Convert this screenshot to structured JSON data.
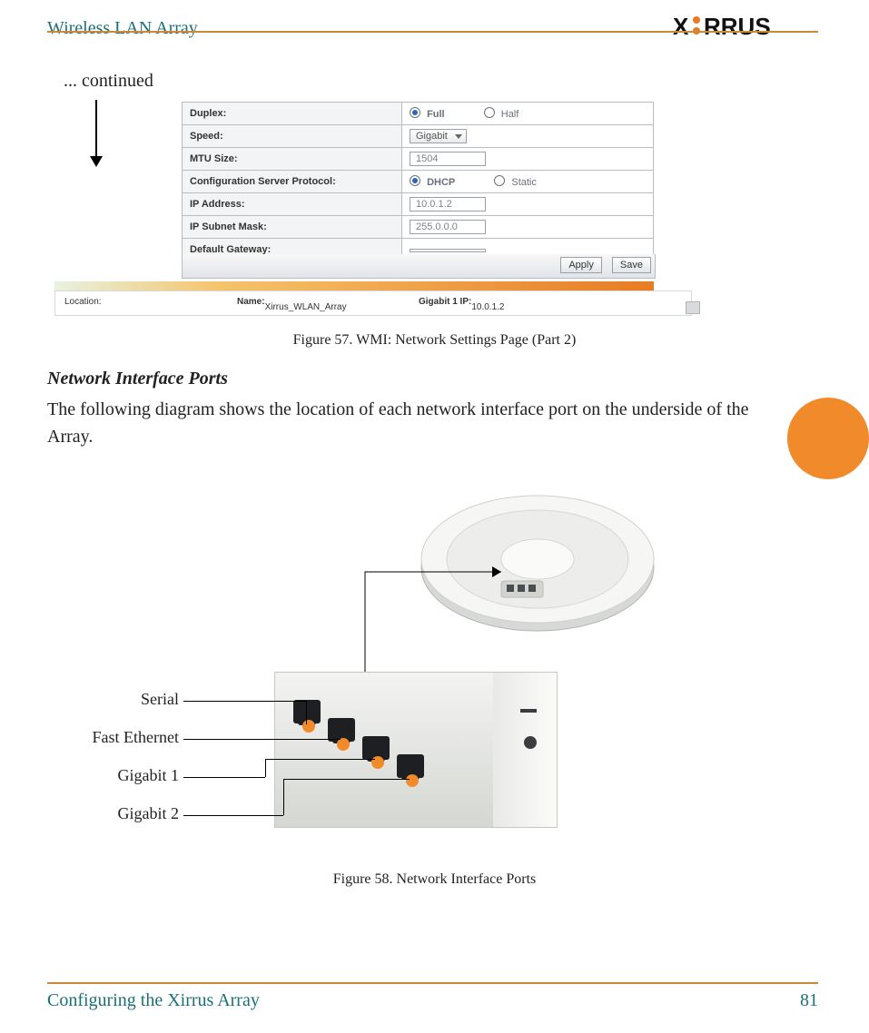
{
  "header": {
    "title": "Wireless LAN Array",
    "logo_text": "XIRRUS"
  },
  "continued": "... continued",
  "wmi": {
    "rows": [
      {
        "label": "Duplex:",
        "type": "radio",
        "opt1": "Full",
        "opt2": "Half",
        "sel": 1
      },
      {
        "label": "Speed:",
        "type": "select",
        "value": "Gigabit"
      },
      {
        "label": "MTU Size:",
        "type": "text",
        "value": "1504"
      },
      {
        "label": "Configuration Server Protocol:",
        "type": "radio",
        "opt1": "DHCP",
        "opt2": "Static",
        "sel": 1
      },
      {
        "label": "IP Address:",
        "type": "text",
        "value": "10.0.1.2"
      },
      {
        "label": "IP Subnet Mask:",
        "type": "text",
        "value": "255.0.0.0"
      },
      {
        "label": "Default Gateway:",
        "type": "text",
        "value": ""
      }
    ],
    "buttons": {
      "apply": "Apply",
      "save": "Save"
    },
    "status": {
      "location_label": "Location:",
      "name_label": "Name:",
      "name_value": "Xirrus_WLAN_Array",
      "ip_label": "Gigabit 1 IP:",
      "ip_value": "10.0.1.2"
    }
  },
  "captions": {
    "fig57": "Figure 57. WMI: Network Settings Page (Part 2)",
    "fig58": "Figure 58. Network Interface Ports"
  },
  "section_heading": "Network Interface Ports",
  "section_para": "The following diagram shows the location of each network interface port on the underside of the Array.",
  "port_labels": {
    "serial": "Serial",
    "fast_eth": "Fast Ethernet",
    "gig1": "Gigabit 1",
    "gig2": "Gigabit 2"
  },
  "footer": {
    "left": "Configuring the Xirrus Array",
    "page": "81"
  }
}
